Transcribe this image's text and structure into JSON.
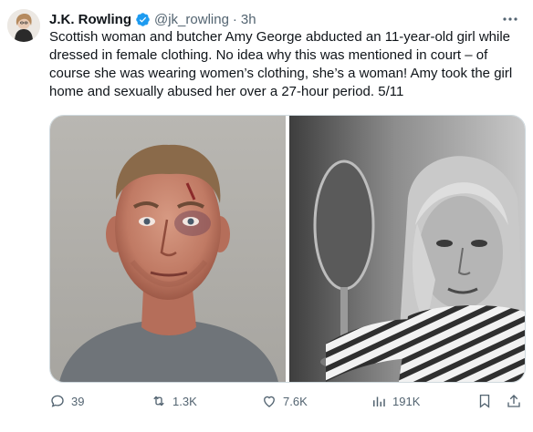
{
  "author": {
    "name": "J.K. Rowling",
    "handle": "@jk_rowling",
    "separator": "·",
    "time": "3h"
  },
  "tweet": {
    "text": "Scottish woman and butcher Amy George abducted an 11-year-old girl while dressed in female clothing. No idea why this was mentioned in court – of course she was wearing women’s clothing, she’s a woman! Amy took the girl home and sexually abused her over a 27-hour period. 5/11"
  },
  "metrics": {
    "replies": "39",
    "reposts": "1.3K",
    "likes": "7.6K",
    "views": "191K"
  },
  "colors": {
    "verified": "#1d9bf0",
    "muted": "#536471",
    "border": "#cfd9de"
  },
  "icons": [
    "verified-badge-icon",
    "more-icon",
    "reply-icon",
    "repost-icon",
    "like-icon",
    "views-icon",
    "bookmark-icon",
    "share-icon"
  ]
}
